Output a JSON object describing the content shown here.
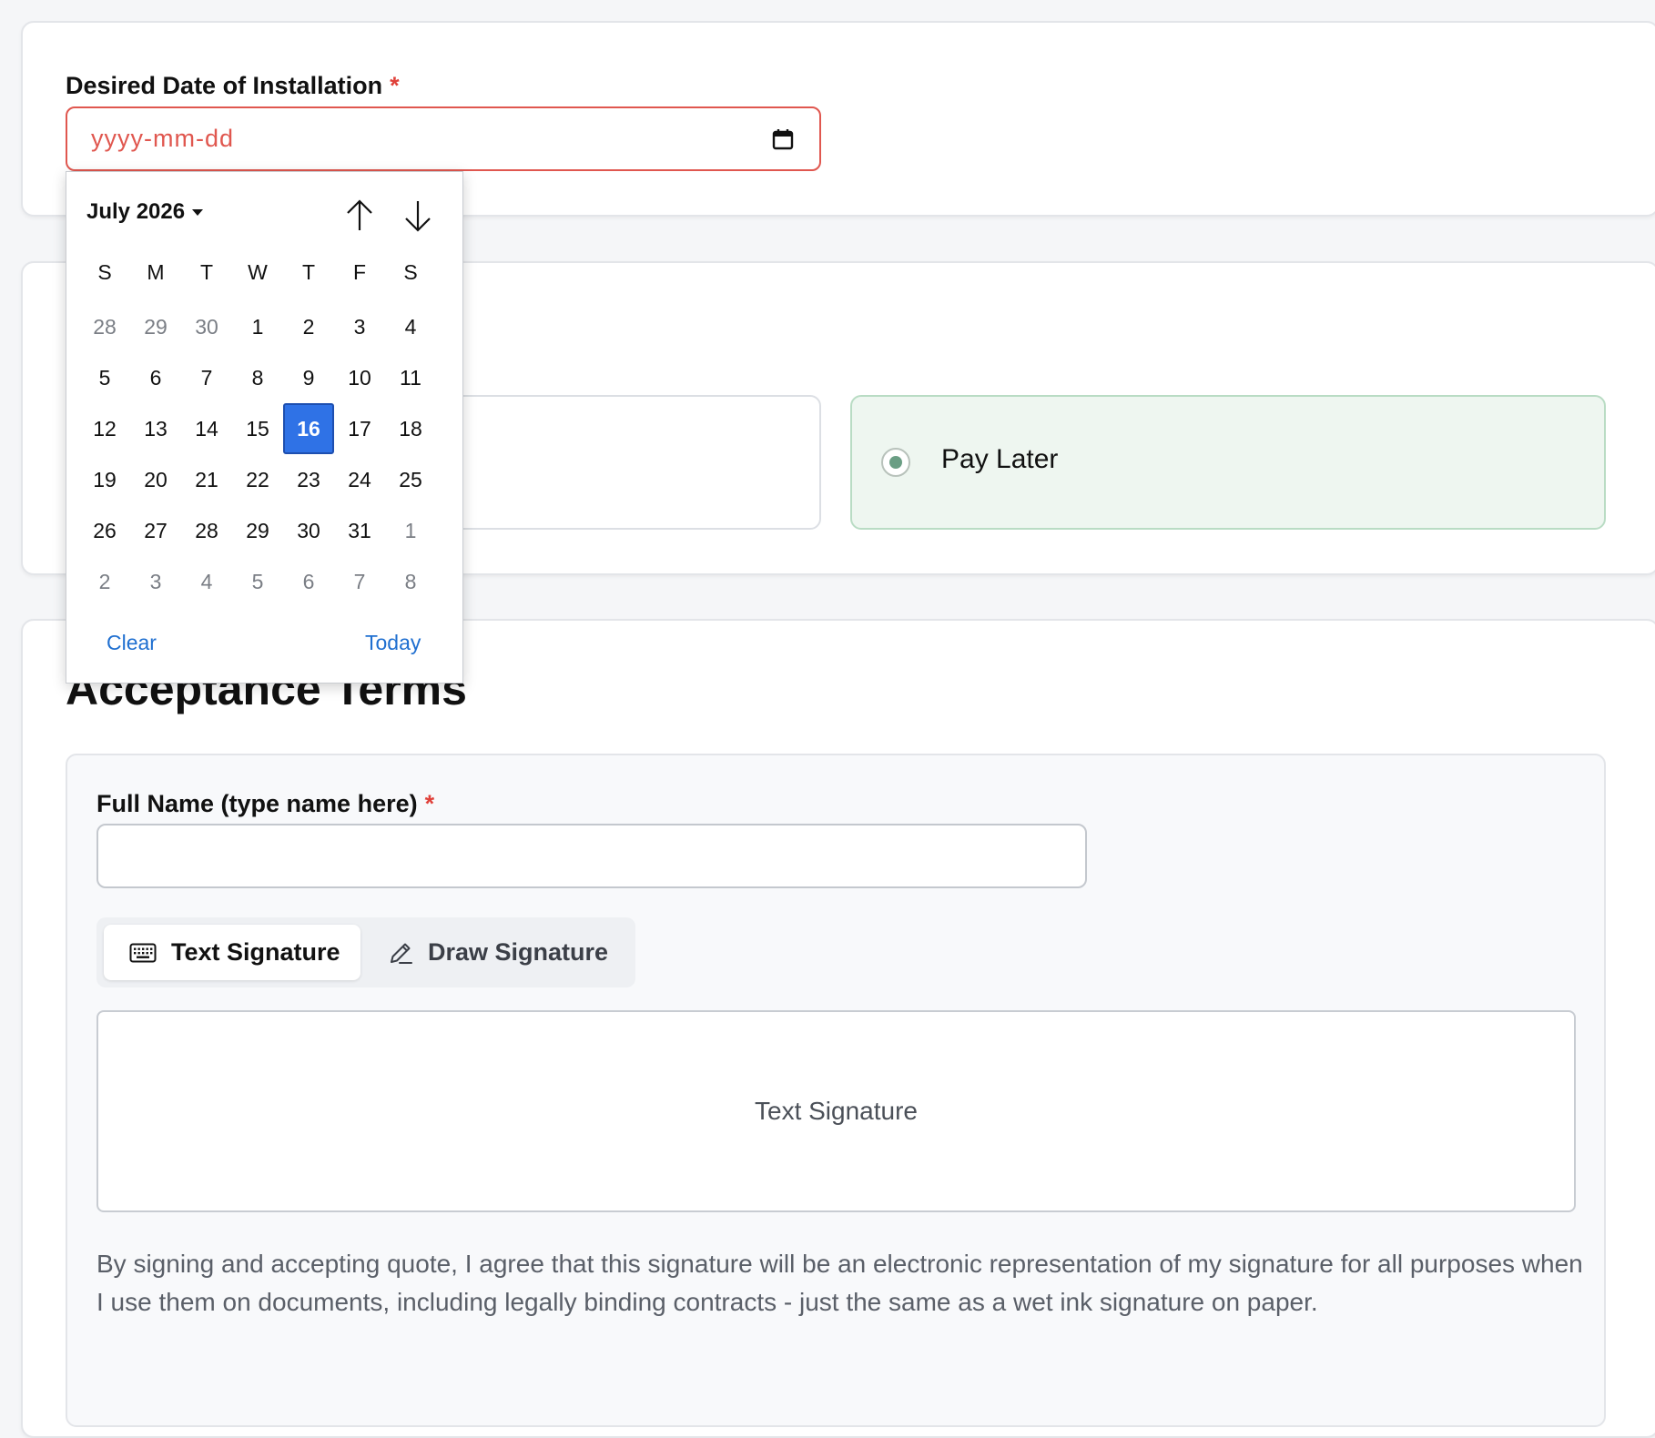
{
  "install_date": {
    "label": "Desired Date of Installation",
    "required_mark": "*",
    "placeholder": "yyyy-mm-dd"
  },
  "payment": {
    "left_option_label": "",
    "right_option_label": "Pay Later"
  },
  "acceptance": {
    "title": "Acceptance Terms",
    "full_name_label": "Full Name (type name here)",
    "required_mark": "*",
    "tabs": {
      "text": "Text Signature",
      "draw": "Draw Signature"
    },
    "signature_placeholder": "Text Signature",
    "terms_text": "By signing and accepting quote, I agree that this signature will be an electronic representation of my signature for all purposes when I use them on documents, including legally binding contracts - just the same as a wet ink signature on paper."
  },
  "datepicker": {
    "month_label": "July 2026",
    "weekdays": [
      "S",
      "M",
      "T",
      "W",
      "T",
      "F",
      "S"
    ],
    "days": [
      {
        "d": "28",
        "out": true
      },
      {
        "d": "29",
        "out": true
      },
      {
        "d": "30",
        "out": true
      },
      {
        "d": "1"
      },
      {
        "d": "2"
      },
      {
        "d": "3"
      },
      {
        "d": "4"
      },
      {
        "d": "5"
      },
      {
        "d": "6"
      },
      {
        "d": "7"
      },
      {
        "d": "8"
      },
      {
        "d": "9"
      },
      {
        "d": "10"
      },
      {
        "d": "11"
      },
      {
        "d": "12"
      },
      {
        "d": "13"
      },
      {
        "d": "14"
      },
      {
        "d": "15"
      },
      {
        "d": "16",
        "selected": true
      },
      {
        "d": "17"
      },
      {
        "d": "18"
      },
      {
        "d": "19"
      },
      {
        "d": "20"
      },
      {
        "d": "21"
      },
      {
        "d": "22"
      },
      {
        "d": "23"
      },
      {
        "d": "24"
      },
      {
        "d": "25"
      },
      {
        "d": "26"
      },
      {
        "d": "27"
      },
      {
        "d": "28"
      },
      {
        "d": "29"
      },
      {
        "d": "30"
      },
      {
        "d": "31"
      },
      {
        "d": "1",
        "out": true
      },
      {
        "d": "2",
        "out": true
      },
      {
        "d": "3",
        "out": true
      },
      {
        "d": "4",
        "out": true
      },
      {
        "d": "5",
        "out": true
      },
      {
        "d": "6",
        "out": true
      },
      {
        "d": "7",
        "out": true
      },
      {
        "d": "8",
        "out": true
      }
    ],
    "clear_label": "Clear",
    "today_label": "Today"
  },
  "colors": {
    "required": "#e0413a",
    "selected_day": "#2f72e6",
    "link": "#1f6fd0",
    "pay_later_bg": "#eef6f0"
  }
}
